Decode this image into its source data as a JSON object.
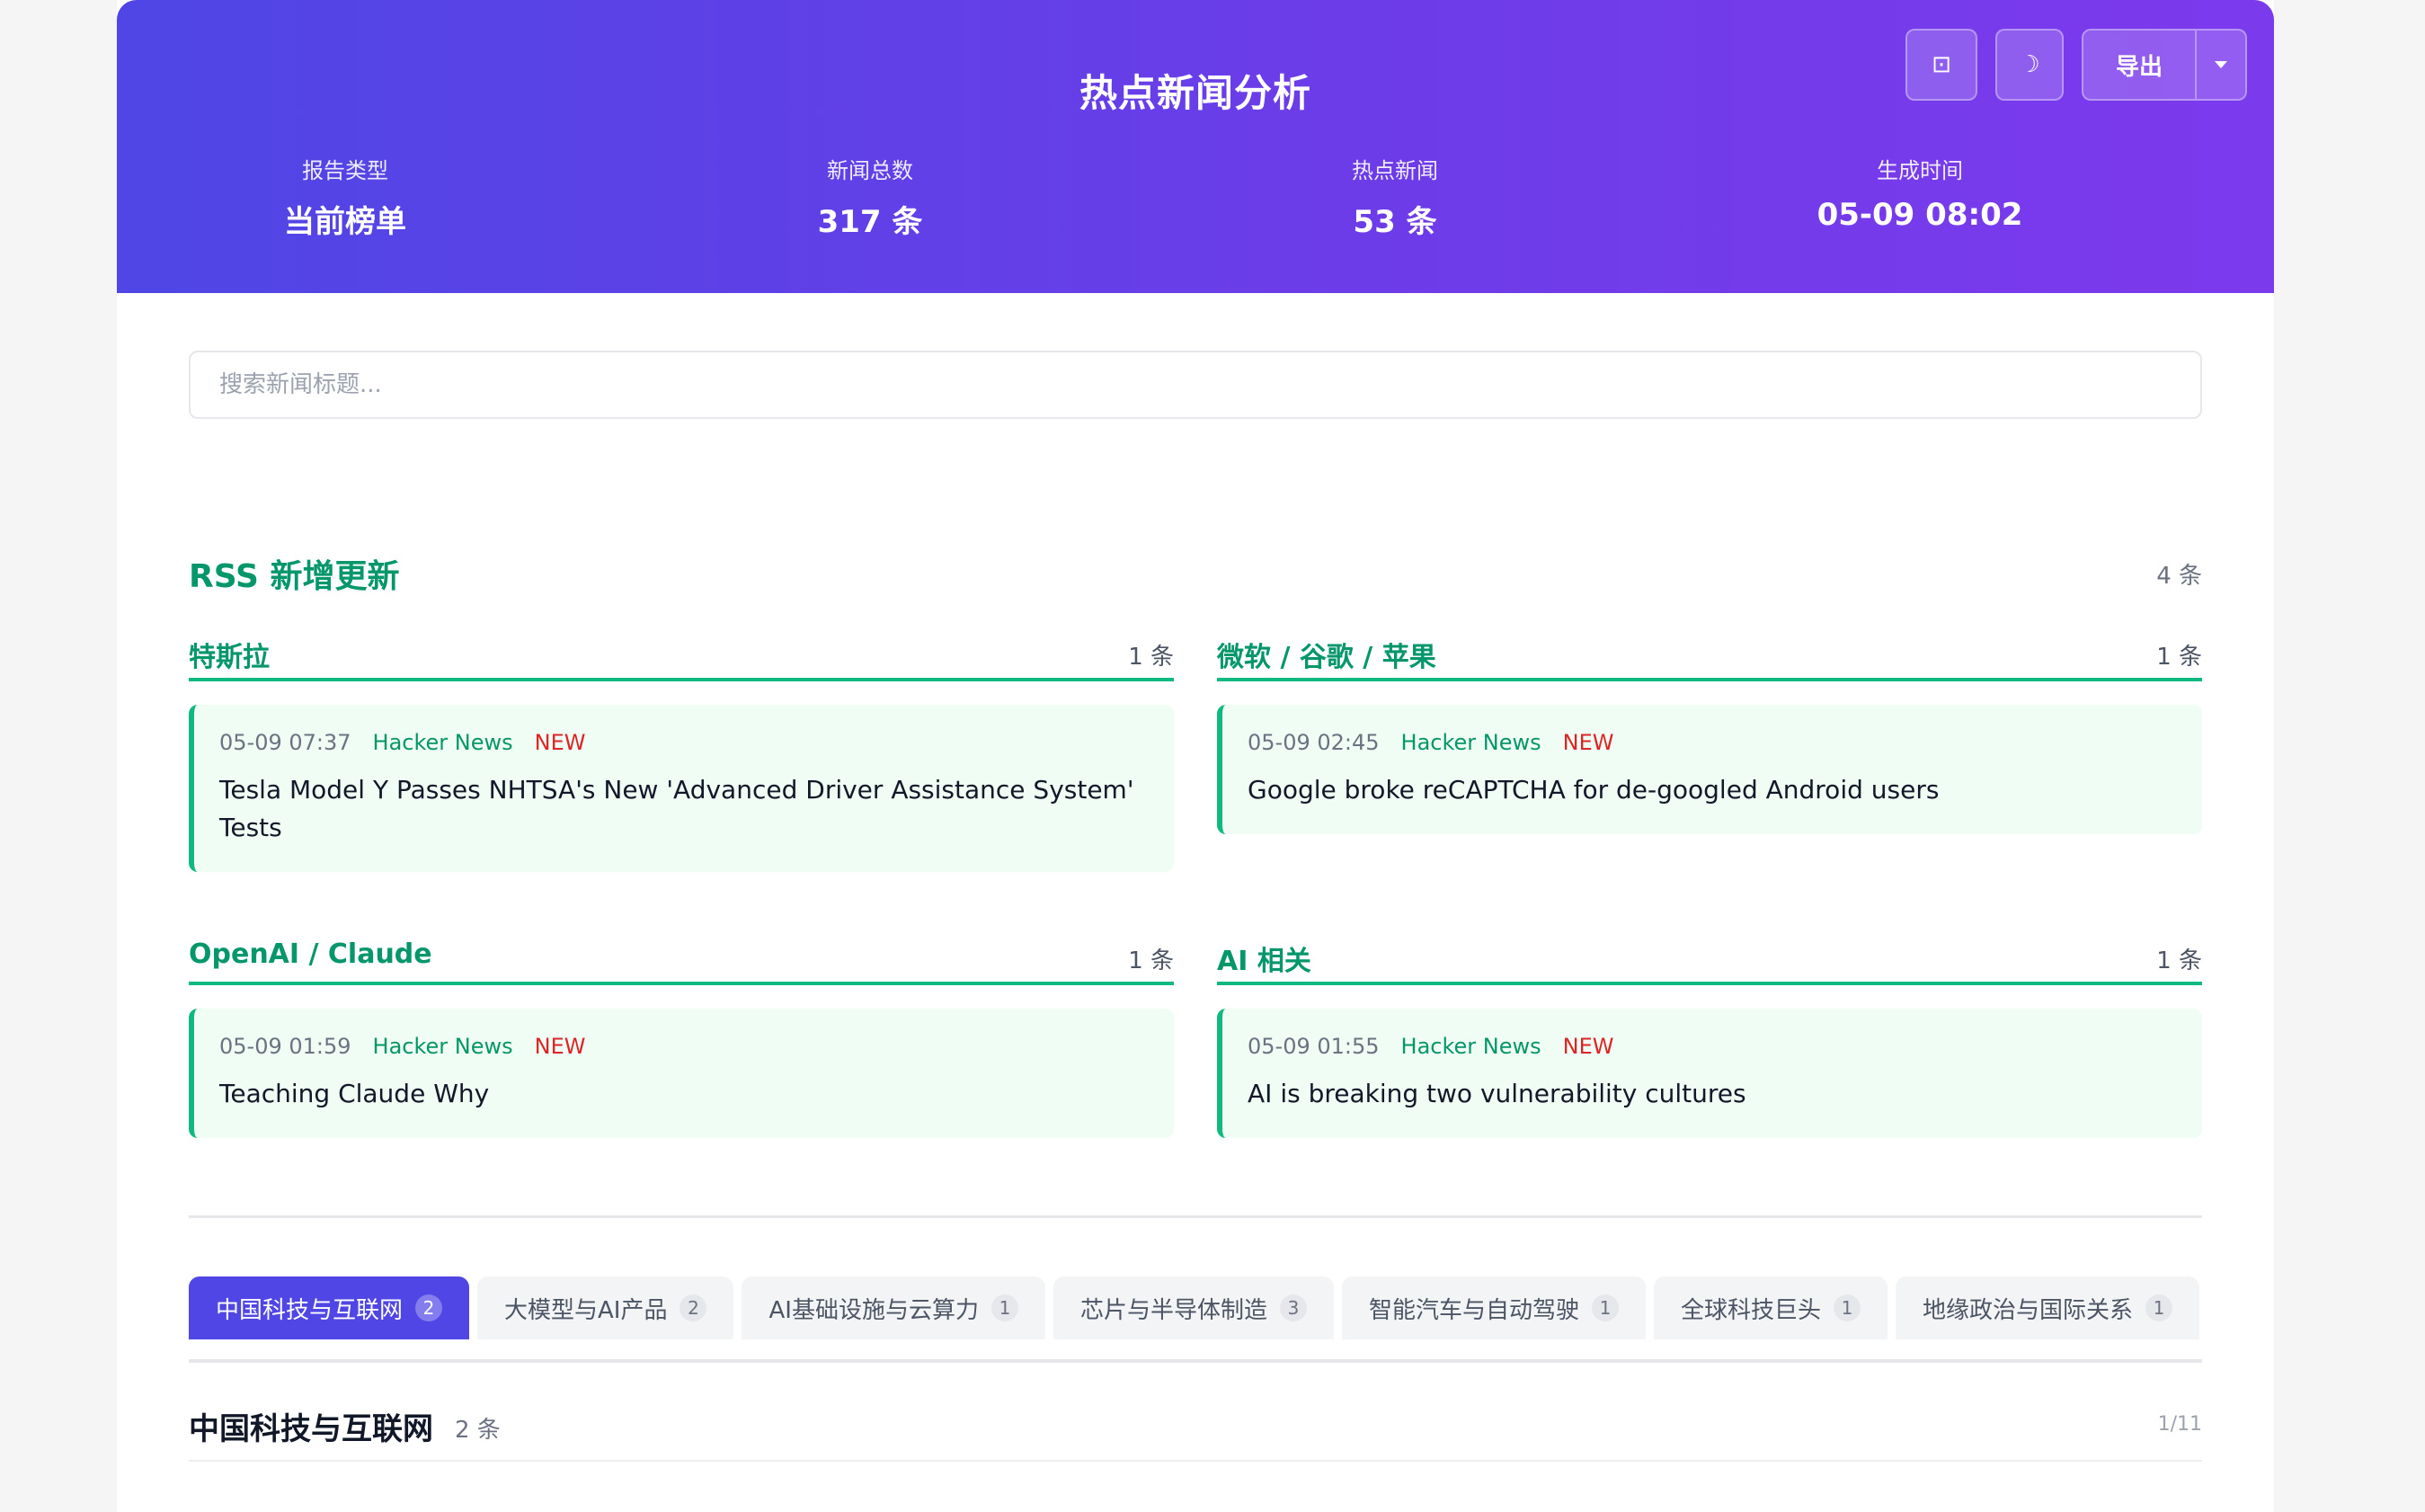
{
  "header": {
    "title": "热点新闻分析",
    "fullscreen_icon": "⊡",
    "darkmode_icon": "☽",
    "export_label": "导出",
    "stats": [
      {
        "label": "报告类型",
        "value": "当前榜单"
      },
      {
        "label": "新闻总数",
        "value": "317 条"
      },
      {
        "label": "热点新闻",
        "value": "53 条"
      },
      {
        "label": "生成时间",
        "value": "05-09 08:02"
      }
    ]
  },
  "search": {
    "placeholder": "搜索新闻标题..."
  },
  "rss": {
    "title": "RSS 新增更新",
    "count": "4 条",
    "groups": [
      {
        "name": "特斯拉",
        "count": "1 条",
        "items": [
          {
            "time": "05-09 07:37",
            "source": "Hacker News",
            "badge": "NEW",
            "title": "Tesla Model Y Passes NHTSA's New 'Advanced Driver Assistance System' Tests"
          }
        ]
      },
      {
        "name": "微软 / 谷歌 / 苹果",
        "count": "1 条",
        "items": [
          {
            "time": "05-09 02:45",
            "source": "Hacker News",
            "badge": "NEW",
            "title": "Google broke reCAPTCHA for de-googled Android users"
          }
        ]
      },
      {
        "name": "OpenAI / Claude",
        "count": "1 条",
        "items": [
          {
            "time": "05-09 01:59",
            "source": "Hacker News",
            "badge": "NEW",
            "title": "Teaching Claude Why"
          }
        ]
      },
      {
        "name": "AI 相关",
        "count": "1 条",
        "items": [
          {
            "time": "05-09 01:55",
            "source": "Hacker News",
            "badge": "NEW",
            "title": "AI is breaking two vulnerability cultures"
          }
        ]
      }
    ]
  },
  "tabs": [
    {
      "label": "中国科技与互联网",
      "count": "2",
      "active": true
    },
    {
      "label": "大模型与AI产品",
      "count": "2"
    },
    {
      "label": "AI基础设施与云算力",
      "count": "1"
    },
    {
      "label": "芯片与半导体制造",
      "count": "3"
    },
    {
      "label": "智能汽车与自动驾驶",
      "count": "1"
    },
    {
      "label": "全球科技巨头",
      "count": "1"
    },
    {
      "label": "地缘政治与国际关系",
      "count": "1"
    }
  ],
  "section": {
    "title": "中国科技与互联网",
    "count": "2 条",
    "page": "1/11"
  },
  "colors": {
    "accent": "#4f46e5",
    "rss_green": "#059669",
    "new_red": "#dc2626"
  }
}
